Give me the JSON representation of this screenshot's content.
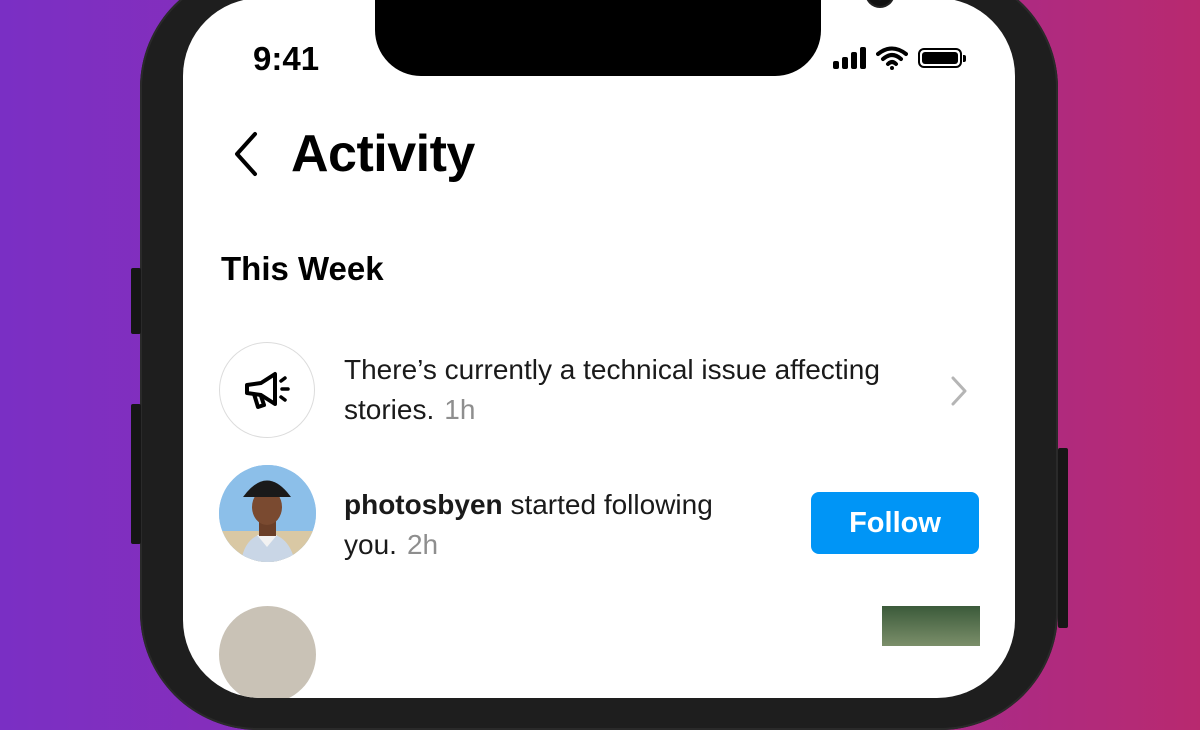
{
  "status_bar": {
    "time": "9:41"
  },
  "header": {
    "title": "Activity"
  },
  "section": {
    "title": "This Week"
  },
  "notifications": [
    {
      "icon": "megaphone-icon",
      "text": "There’s currently a technical issue affecting stories.",
      "time": "1h"
    },
    {
      "username": "photosbyen",
      "text": " started following you.",
      "time": "2h",
      "button_label": "Follow"
    }
  ],
  "colors": {
    "accent": "#0095f6",
    "muted_text": "#8e8e8e",
    "background_gradient_left": "#7a2fc4",
    "background_gradient_right": "#b8296f"
  }
}
